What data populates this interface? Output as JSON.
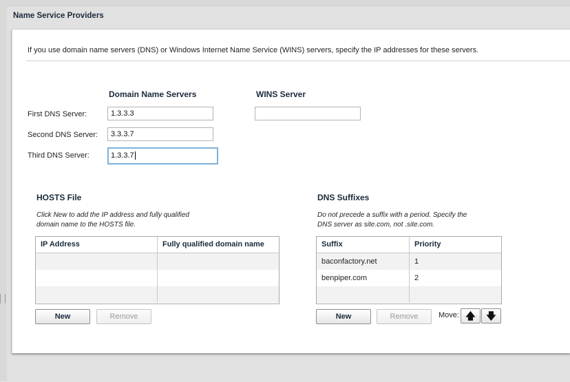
{
  "panel": {
    "title": "Name Service Providers",
    "intro": "If you use domain name servers (DNS) or Windows Internet Name Service (WINS) servers, specify the IP addresses for these servers."
  },
  "dns": {
    "heading_dns": "Domain Name Servers",
    "heading_wins": "WINS Server",
    "first_label": "First DNS Server:",
    "first_value": "1.3.3.3",
    "second_label": "Second DNS Server:",
    "second_value": "3.3.3.7",
    "third_label": "Third DNS Server:",
    "third_value": "1.3.3.7",
    "wins_value": ""
  },
  "hosts": {
    "heading": "HOSTS File",
    "hint_line1": "Click New to add the IP address and fully qualified",
    "hint_line2": "domain name to the HOSTS file.",
    "columns": [
      "IP Address",
      "Fully qualified domain name"
    ],
    "rows": [
      [
        "",
        ""
      ],
      [
        "",
        ""
      ],
      [
        "",
        ""
      ]
    ],
    "new_label": "New",
    "remove_label": "Remove"
  },
  "suffixes": {
    "heading": "DNS Suffixes",
    "hint_line1": "Do not precede a suffix with a period. Specify the",
    "hint_line2": "DNS server as site.com, not .site.com.",
    "columns": [
      "Suffix",
      "Priority"
    ],
    "rows": [
      [
        "baconfactory.net",
        "1"
      ],
      [
        "benpiper.com",
        "2"
      ],
      [
        "",
        ""
      ]
    ],
    "new_label": "New",
    "remove_label": "Remove",
    "move_label": "Move:",
    "up_icon": "arrow-up-icon",
    "down_icon": "arrow-down-icon"
  }
}
